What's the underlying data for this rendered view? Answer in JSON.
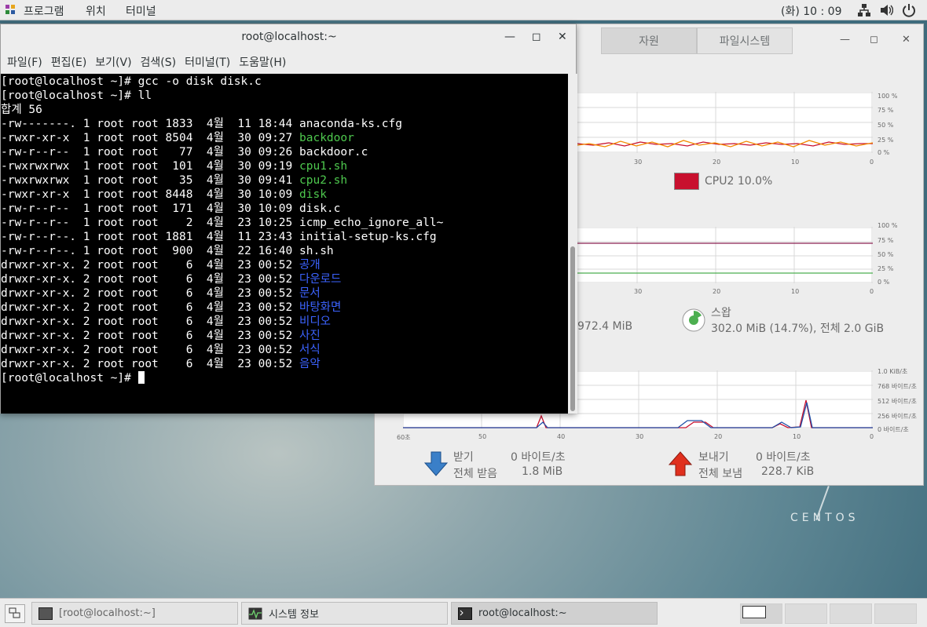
{
  "topbar": {
    "applications": "프로그램",
    "places": "위치",
    "terminal": "터미널",
    "clock": "(화) 10 : 09"
  },
  "sysmon": {
    "tabs": [
      "자원",
      "파일시스템"
    ],
    "cpu_legend": "CPU2 10.0%",
    "cpu_color": "#c8102e",
    "mem_partial": "972.4 MiB",
    "swap_label": "스왑",
    "swap_value": "302.0 MiB (14.7%), 전체 2.0 GiB",
    "cpu_yticks": [
      "100 %",
      "75 %",
      "50 %",
      "25 %",
      "0 %"
    ],
    "xticks": [
      "30",
      "20",
      "10",
      "0"
    ],
    "net_yticks": [
      "1.0 KiB/초",
      "768 바이트/초",
      "512 바이트/초",
      "256 바이트/초",
      "0 바이트/초"
    ],
    "net_xticks": [
      "60초",
      "50",
      "40",
      "30",
      "20",
      "10",
      "0"
    ],
    "recv_label": "받기",
    "recv_rate": "0 바이트/초",
    "recv_total_label": "전체 받음",
    "recv_total": "1.8 MiB",
    "send_label": "보내기",
    "send_rate": "0 바이트/초",
    "send_total_label": "전체 보냄",
    "send_total": "228.7 KiB",
    "branding": "CENTOS"
  },
  "terminal": {
    "title": "root@localhost:~",
    "menu": [
      "파일(F)",
      "편집(E)",
      "보기(V)",
      "검색(S)",
      "터미널(T)",
      "도움말(H)"
    ],
    "lines": [
      {
        "text": "[root@localhost ~]# gcc -o disk disk.c",
        "name": ""
      },
      {
        "text": "[root@localhost ~]# ll",
        "name": ""
      },
      {
        "text": "합계 56",
        "name": ""
      },
      {
        "text": "-rw-------. 1 root root 1833  4월  11 18:44 ",
        "name": "anaconda-ks.cfg",
        "color": ""
      },
      {
        "text": "-rwxr-xr-x  1 root root 8504  4월  30 09:27 ",
        "name": "backdoor",
        "color": "g"
      },
      {
        "text": "-rw-r--r--  1 root root   77  4월  30 09:26 ",
        "name": "backdoor.c",
        "color": ""
      },
      {
        "text": "-rwxrwxrwx  1 root root  101  4월  30 09:19 ",
        "name": "cpu1.sh",
        "color": "g"
      },
      {
        "text": "-rwxrwxrwx  1 root root   35  4월  30 09:41 ",
        "name": "cpu2.sh",
        "color": "g"
      },
      {
        "text": "-rwxr-xr-x  1 root root 8448  4월  30 10:09 ",
        "name": "disk",
        "color": "g"
      },
      {
        "text": "-rw-r--r--  1 root root  171  4월  30 10:09 ",
        "name": "disk.c",
        "color": ""
      },
      {
        "text": "-rw-r--r--  1 root root    2  4월  23 10:25 ",
        "name": "icmp_echo_ignore_all~",
        "color": ""
      },
      {
        "text": "-rw-r--r--. 1 root root 1881  4월  11 23:43 ",
        "name": "initial-setup-ks.cfg",
        "color": ""
      },
      {
        "text": "-rw-r--r--. 1 root root  900  4월  22 16:40 ",
        "name": "sh.sh",
        "color": ""
      },
      {
        "text": "drwxr-xr-x. 2 root root    6  4월  23 00:52 ",
        "name": "공개",
        "color": "b"
      },
      {
        "text": "drwxr-xr-x. 2 root root    6  4월  23 00:52 ",
        "name": "다운로드",
        "color": "b"
      },
      {
        "text": "drwxr-xr-x. 2 root root    6  4월  23 00:52 ",
        "name": "문서",
        "color": "b"
      },
      {
        "text": "drwxr-xr-x. 2 root root    6  4월  23 00:52 ",
        "name": "바탕화면",
        "color": "b"
      },
      {
        "text": "drwxr-xr-x. 2 root root    6  4월  23 00:52 ",
        "name": "비디오",
        "color": "b"
      },
      {
        "text": "drwxr-xr-x. 2 root root    6  4월  23 00:52 ",
        "name": "사진",
        "color": "b"
      },
      {
        "text": "drwxr-xr-x. 2 root root    6  4월  23 00:52 ",
        "name": "서식",
        "color": "b"
      },
      {
        "text": "drwxr-xr-x. 2 root root    6  4월  23 00:52 ",
        "name": "음악",
        "color": "b"
      }
    ],
    "prompt": "[root@localhost ~]# "
  },
  "taskbar": {
    "tasks": [
      "[root@localhost:~]",
      "시스템 정보",
      "root@localhost:~"
    ]
  }
}
